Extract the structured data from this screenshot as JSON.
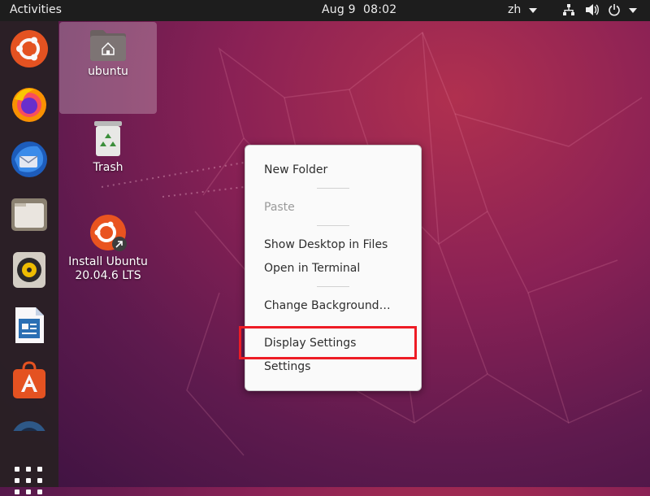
{
  "topbar": {
    "activities": "Activities",
    "date": "Aug 9",
    "time": "08:02",
    "input_method": "zh",
    "icons": [
      "network-icon",
      "volume-icon",
      "power-icon"
    ]
  },
  "dock": {
    "items": [
      "ubuntu-icon",
      "firefox-icon",
      "thunderbird-icon",
      "files-icon",
      "rhythmbox-icon",
      "libreoffice-writer-icon",
      "software-center-icon",
      "help-icon"
    ],
    "show_apps": "show-applications-icon"
  },
  "desktop": {
    "icons": [
      {
        "label": "ubuntu"
      },
      {
        "label": "Trash"
      },
      {
        "label_line1": "Install Ubuntu",
        "label_line2": "20.04.6 LTS"
      }
    ]
  },
  "context_menu": {
    "new_folder": "New Folder",
    "paste": "Paste",
    "show_desktop_in_files": "Show Desktop in Files",
    "open_in_terminal": "Open in Terminal",
    "change_background": "Change Background…",
    "display_settings": "Display Settings",
    "settings": "Settings"
  },
  "colors": {
    "highlight": "#ee1c25",
    "ubuntu_orange": "#e95420",
    "topbar": "#1d1d1d"
  }
}
